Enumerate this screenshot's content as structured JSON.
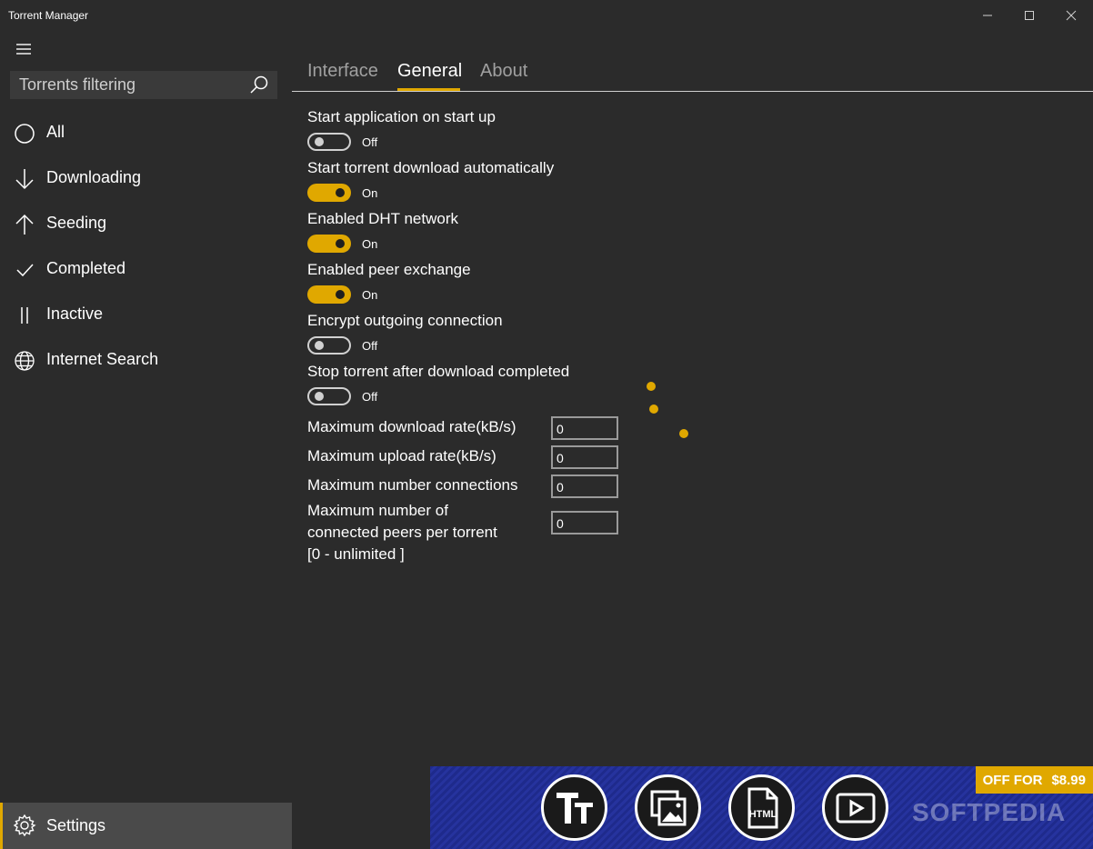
{
  "window": {
    "title": "Torrent Manager"
  },
  "sidebar": {
    "search_placeholder": "Torrents filtering",
    "items": [
      {
        "label": "All",
        "icon": "circle-icon"
      },
      {
        "label": "Downloading",
        "icon": "arrow-down-icon"
      },
      {
        "label": "Seeding",
        "icon": "arrow-up-icon"
      },
      {
        "label": "Completed",
        "icon": "checkmark-icon"
      },
      {
        "label": "Inactive",
        "icon": "pause-icon"
      },
      {
        "label": "Internet Search",
        "icon": "globe-icon"
      }
    ],
    "settings_label": "Settings"
  },
  "tabs": [
    {
      "label": "Interface",
      "active": false
    },
    {
      "label": "General",
      "active": true
    },
    {
      "label": "About",
      "active": false
    }
  ],
  "settings": [
    {
      "label": "Start application on start up",
      "state": "Off"
    },
    {
      "label": "Start torrent download automatically",
      "state": "On"
    },
    {
      "label": "Enabled DHT network",
      "state": "On"
    },
    {
      "label": "Enabled peer exchange",
      "state": "On"
    },
    {
      "label": "Encrypt outgoing connection",
      "state": "Off"
    },
    {
      "label": "Stop torrent after download completed",
      "state": "Off"
    }
  ],
  "fields": [
    {
      "label": "Maximum download rate(kB/s)",
      "value": "0"
    },
    {
      "label": "Maximum upload rate(kB/s)",
      "value": "0"
    },
    {
      "label": "Maximum number connections",
      "value": "0"
    },
    {
      "label_line1": "Maximum number of",
      "label_line2": "connected peers per torrent",
      "label_line3": "[0 -  unlimited ]",
      "value": "0"
    }
  ],
  "ad": {
    "offer_text": "OFF FOR",
    "price": "$8.99",
    "watermark": "SOFTPEDIA",
    "html_icon_text": "HTML"
  },
  "colors": {
    "accent": "#e0a800",
    "background": "#2b2b2b"
  }
}
